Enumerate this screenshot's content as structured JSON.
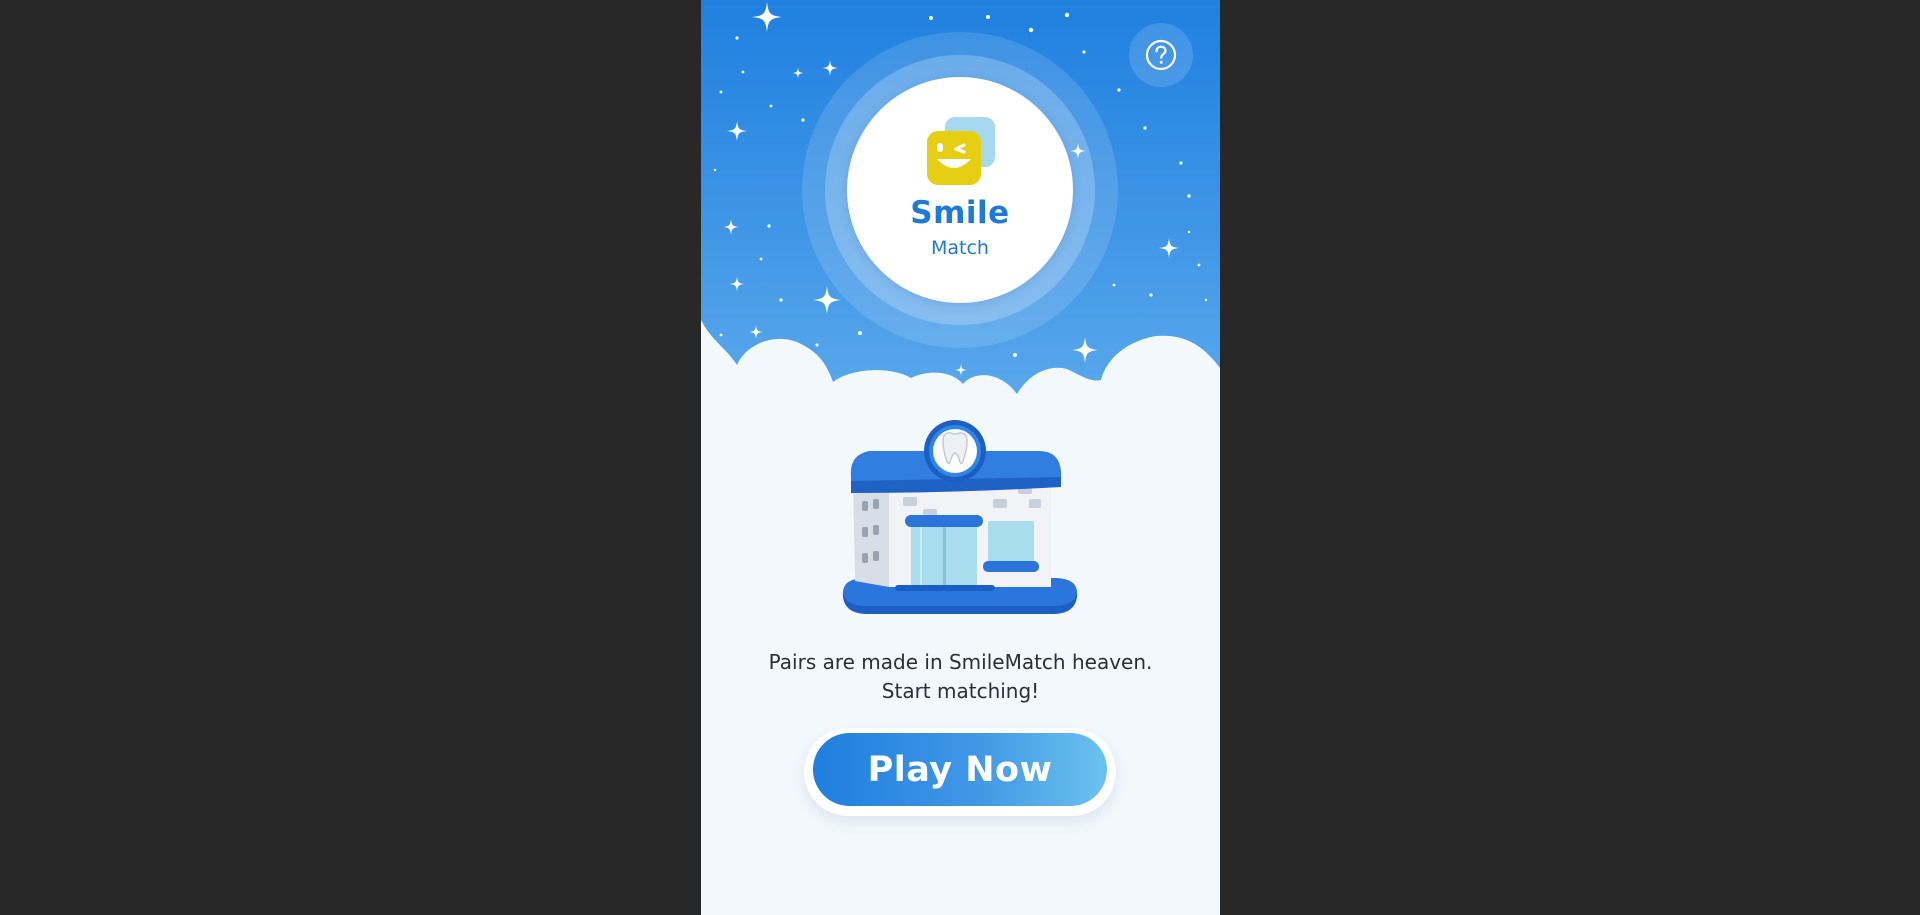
{
  "app": {
    "logo_title": "Smile",
    "logo_subtitle": "Match"
  },
  "tagline": {
    "line1": "Pairs are made in SmileMatch heaven.",
    "line2": "Start matching!"
  },
  "buttons": {
    "play_label": "Play Now",
    "help_icon": "help-circle-icon"
  },
  "illustration": {
    "icon": "dental-clinic-icon",
    "badge_icon": "tooth-icon"
  },
  "colors": {
    "sky": "#1f80e0",
    "accent": "#1e7ad8",
    "logo_yellow": "#e6cf13",
    "background": "#f3f8fd",
    "page_bg": "#282828"
  }
}
